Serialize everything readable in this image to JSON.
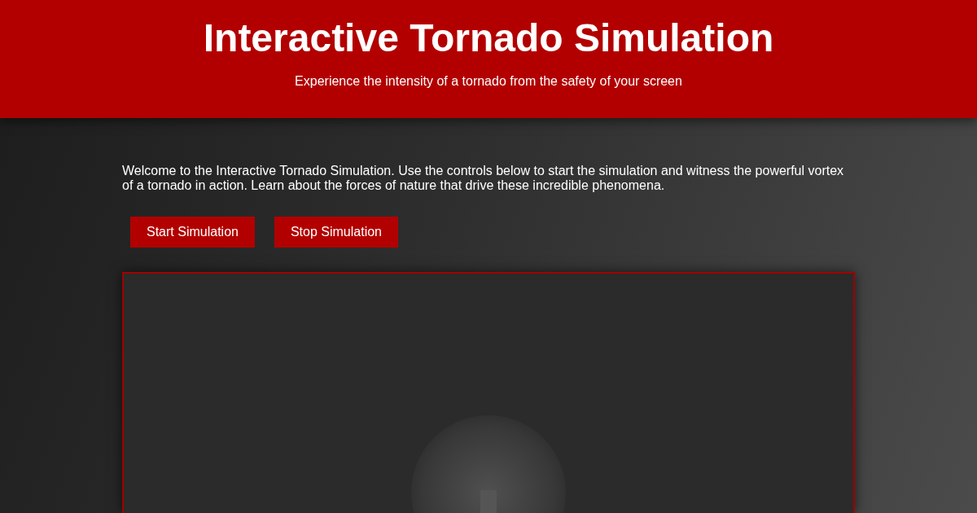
{
  "header": {
    "title": "Interactive Tornado Simulation",
    "subtitle": "Experience the intensity of a tornado from the safety of your screen"
  },
  "intro": "Welcome to the Interactive Tornado Simulation. Use the controls below to start the simulation and witness the powerful vortex of a tornado in action. Learn about the forces of nature that drive these incredible phenomena.",
  "buttons": [
    "Start Simulation",
    "Stop Simulation"
  ]
}
